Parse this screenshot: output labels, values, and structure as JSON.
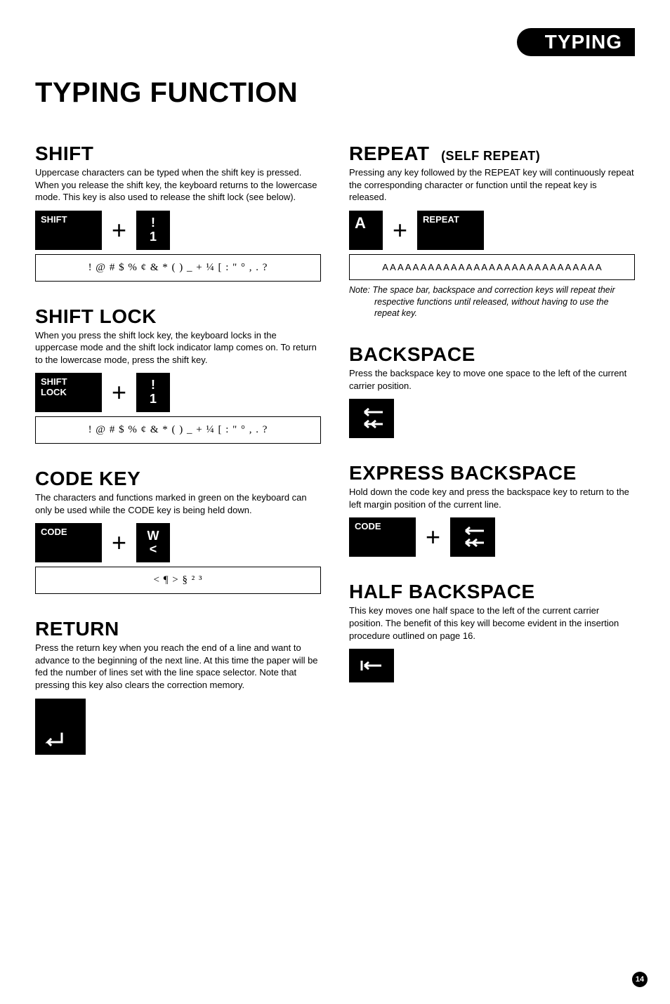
{
  "header_badge": "TYPING",
  "title": "TYPING FUNCTION",
  "page_num": "14",
  "left": {
    "shift": {
      "h": "SHIFT",
      "desc": "Uppercase characters can be typed when the shift key is pressed. When you release the shift key, the keyboard returns to the lowercase mode. This key is also used to release the shift lock (see below).",
      "key_shift": "SHIFT",
      "key_1_top": "!",
      "key_1_bot": "1",
      "output": "! @ # $ % ¢ & * ( ) _ + ¼ [ : \" ° , . ?"
    },
    "shiftlock": {
      "h": "SHIFT LOCK",
      "desc": "When you press the shift lock key, the keyboard locks in the uppercase mode and the shift lock indicator lamp comes on. To return to the lowercase mode, press the shift key.",
      "key_lock": "SHIFT\nLOCK",
      "key_1_top": "!",
      "key_1_bot": "1",
      "output": "! @ # $ % ¢ & * ( ) _ + ¼ [ : \" ° , . ?"
    },
    "code": {
      "h": "CODE KEY",
      "desc": "The characters and functions marked in green on the keyboard can only be used while the CODE key is being held down.",
      "key_code": "CODE",
      "key_w_top": "W",
      "key_w_bot": "<",
      "output": "< ¶ > § ² ³"
    },
    "return": {
      "h": "RETURN",
      "desc": "Press the return key when you reach the end of a line and want to advance to the beginning of the next line. At this time the paper will be fed the number of lines set with the line space selector. Note that pressing this key also clears the correction memory."
    }
  },
  "right": {
    "repeat": {
      "h": "REPEAT",
      "sub": "(SELF REPEAT)",
      "desc": "Pressing any key followed by the REPEAT key will continuously repeat the corresponding character or function until the repeat key is released.",
      "key_a": "A",
      "key_repeat": "REPEAT",
      "output": "A A A A A A A A A A A A A A A A A A A A A A A A A A A A A",
      "note": "Note: The space bar, backspace and correction keys will repeat their respective functions until released, without having to use the repeat key."
    },
    "backspace": {
      "h": "BACKSPACE",
      "desc": "Press the backspace key to move one space to the left of the current carrier position."
    },
    "express": {
      "h": "EXPRESS BACKSPACE",
      "desc": "Hold down the code key and press the backspace key to return to the left margin position of the current line.",
      "key_code": "CODE"
    },
    "half": {
      "h": "HALF BACKSPACE",
      "desc": "This key moves one half space to the left of the current carrier position. The benefit of this key will become evident in the insertion procedure outlined on page 16."
    }
  }
}
